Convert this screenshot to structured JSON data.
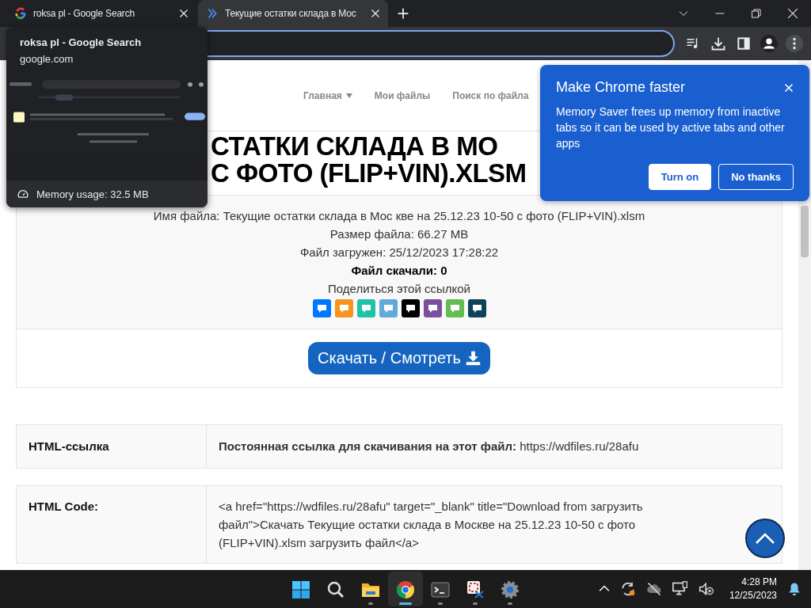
{
  "browser": {
    "tabs": [
      {
        "title": "roksa pl - Google Search",
        "kind": "google",
        "selected": false
      },
      {
        "title": "Текущие остатки склада в Мос",
        "kind": "site",
        "selected": true
      }
    ]
  },
  "hover_card": {
    "title": "roksa pl - Google Search",
    "domain": "google.com",
    "memory": "Memory usage: 32.5 MB"
  },
  "site": {
    "nav": [
      {
        "label": "Главная",
        "dropdown": true
      },
      {
        "label": "Мои файлы",
        "dropdown": false
      },
      {
        "label": "Поиск по файла",
        "dropdown": false
      }
    ],
    "title_lines": [
      "СТАТКИ СКЛАДА В МО",
      "С ФОТО (FLIP+VIN).XLSM"
    ],
    "info": [
      {
        "text": "Имя файла: Текущие остатки склада в Мос кве на 25.12.23 10-50 с фото (FLIP+VIN).xlsm",
        "bold": false
      },
      {
        "text": "Размер файла: 66.27 MB",
        "bold": false
      },
      {
        "text": "Файл загружен: 25/12/2023 17:28:22",
        "bold": false
      },
      {
        "text": "Файл скачали: 0",
        "bold": true
      },
      {
        "text": "Поделиться этой ссылкой",
        "bold": false
      }
    ],
    "share_icons": [
      {
        "color": "#0077ff"
      },
      {
        "color": "#f7931e"
      },
      {
        "color": "#1fc2a7"
      },
      {
        "color": "#64a9dc"
      },
      {
        "color": "#000000"
      },
      {
        "color": "#7b519d"
      },
      {
        "color": "#65bc54"
      },
      {
        "color": "#0d425a"
      }
    ],
    "download_button": "Скачать / Смотреть",
    "rows": [
      {
        "label": "HTML-ссылка",
        "value": "**Постоянная ссылка для скачивания на этот файл:** https://wdfiles.ru/28afu"
      },
      {
        "label": "HTML Code:",
        "value": "<a href=\"https://wdfiles.ru/28afu\" target=\"_blank\" title=\"Download from загрузить файл\">Скачать Текущие остатки склада в Москве на 25.12.23 10-50 с фото (FLIP+VIN).xlsm загрузить файл</a>"
      }
    ]
  },
  "popup": {
    "title": "Make Chrome faster",
    "body": "Memory Saver frees up memory from inactive tabs so it can be used by active tabs and other apps",
    "buttons": [
      {
        "label": "Turn on",
        "kind": "primary"
      },
      {
        "label": "No thanks",
        "kind": "secondary"
      }
    ]
  },
  "taskbar": {
    "apps": [
      {
        "kind": "windows",
        "running": false,
        "selected": false
      },
      {
        "kind": "search",
        "running": false,
        "selected": false
      },
      {
        "kind": "folder",
        "running": true,
        "selected": false
      },
      {
        "kind": "chrome",
        "running": true,
        "selected": true
      },
      {
        "kind": "terminal",
        "running": true,
        "selected": false
      },
      {
        "kind": "snipping",
        "running": true,
        "selected": false
      },
      {
        "kind": "settings",
        "running": true,
        "selected": false
      }
    ],
    "time": "4:28 PM",
    "date": "12/25/2023"
  }
}
